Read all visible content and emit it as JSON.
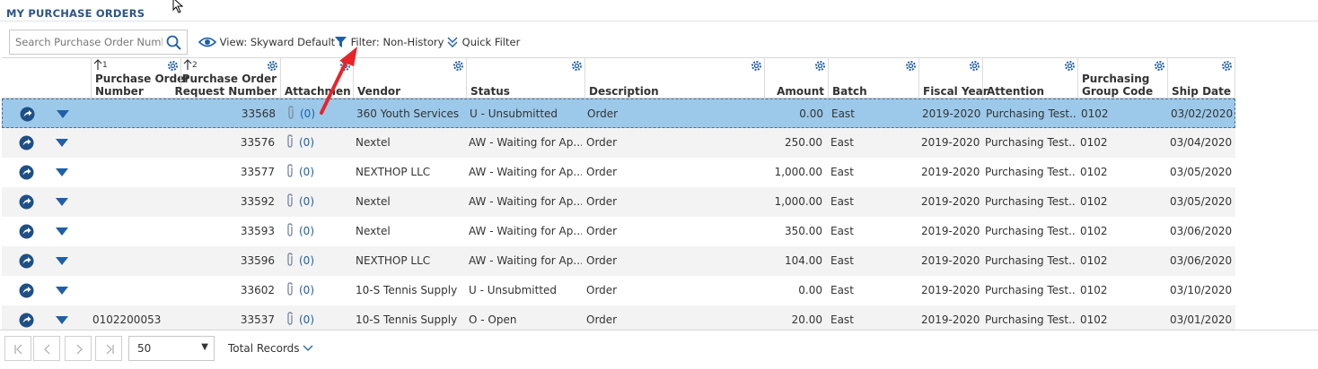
{
  "page": {
    "title": "MY PURCHASE ORDERS"
  },
  "toolbar": {
    "search_placeholder": "Search Purchase Order Number",
    "view_label": "View: Skyward Default",
    "filter_label": "Filter: Non-History",
    "quick_filter_label": "Quick Filter"
  },
  "colors": {
    "accent": "#2c5585",
    "icon_blue": "#1f5fa8",
    "selected_row": "#9cc9ea",
    "annotation_arrow": "#e8242a"
  },
  "columns": [
    {
      "key": "po_number",
      "label1": "Purchase Order",
      "label2": "Number",
      "sort_rank": "1"
    },
    {
      "key": "por_number",
      "label1": "Purchase Order",
      "label2": "Request Number",
      "sort_rank": "2"
    },
    {
      "key": "attachments",
      "label1": "",
      "label2": "Attachments"
    },
    {
      "key": "vendor",
      "label1": "",
      "label2": "Vendor"
    },
    {
      "key": "status",
      "label1": "",
      "label2": "Status"
    },
    {
      "key": "description",
      "label1": "",
      "label2": "Description"
    },
    {
      "key": "amount",
      "label1": "",
      "label2": "Amount"
    },
    {
      "key": "batch",
      "label1": "",
      "label2": "Batch"
    },
    {
      "key": "fiscal_year",
      "label1": "",
      "label2": "Fiscal Year"
    },
    {
      "key": "attention",
      "label1": "",
      "label2": "Attention"
    },
    {
      "key": "pgc",
      "label1": "Purchasing",
      "label2": "Group Code"
    },
    {
      "key": "ship_date",
      "label1": "",
      "label2": "Ship Date"
    }
  ],
  "rows": [
    {
      "po": "",
      "por": "33568",
      "att": "(0)",
      "vendor": "360 Youth Services",
      "status": "U - Unsubmitted",
      "desc": "Order",
      "amount": "0.00",
      "batch": "East",
      "fy": "2019-2020",
      "attention": "Purchasing Test...",
      "pgc": "0102",
      "ship": "03/02/2020",
      "selected": true
    },
    {
      "po": "",
      "por": "33576",
      "att": "(0)",
      "vendor": "Nextel",
      "status": "AW - Waiting for Ap...",
      "desc": "Order",
      "amount": "250.00",
      "batch": "East",
      "fy": "2019-2020",
      "attention": "Purchasing Test...",
      "pgc": "0102",
      "ship": "03/04/2020"
    },
    {
      "po": "",
      "por": "33577",
      "att": "(0)",
      "vendor": "NEXTHOP LLC",
      "status": "AW - Waiting for Ap...",
      "desc": "Order",
      "amount": "1,000.00",
      "batch": "East",
      "fy": "2019-2020",
      "attention": "Purchasing Test...",
      "pgc": "0102",
      "ship": "03/05/2020"
    },
    {
      "po": "",
      "por": "33592",
      "att": "(0)",
      "vendor": "Nextel",
      "status": "AW - Waiting for Ap...",
      "desc": "Order",
      "amount": "1,000.00",
      "batch": "East",
      "fy": "2019-2020",
      "attention": "Purchasing Test...",
      "pgc": "0102",
      "ship": "03/05/2020"
    },
    {
      "po": "",
      "por": "33593",
      "att": "(0)",
      "vendor": "Nextel",
      "status": "AW - Waiting for Ap...",
      "desc": "Order",
      "amount": "350.00",
      "batch": "East",
      "fy": "2019-2020",
      "attention": "Purchasing Test...",
      "pgc": "0102",
      "ship": "03/06/2020"
    },
    {
      "po": "",
      "por": "33596",
      "att": "(0)",
      "vendor": "NEXTHOP LLC",
      "status": "AW - Waiting for Ap...",
      "desc": "Order",
      "amount": "104.00",
      "batch": "East",
      "fy": "2019-2020",
      "attention": "Purchasing Test...",
      "pgc": "0102",
      "ship": "03/06/2020"
    },
    {
      "po": "",
      "por": "33602",
      "att": "(0)",
      "vendor": "10-S Tennis Supply",
      "status": "U - Unsubmitted",
      "desc": "Order",
      "amount": "0.00",
      "batch": "East",
      "fy": "2019-2020",
      "attention": "Purchasing Test...",
      "pgc": "0102",
      "ship": "03/10/2020"
    },
    {
      "po": "0102200053",
      "por": "33537",
      "att": "(0)",
      "vendor": "10-S Tennis Supply",
      "status": "O - Open",
      "desc": "Order",
      "amount": "20.00",
      "batch": "East",
      "fy": "2019-2020",
      "attention": "Purchasing Test...",
      "pgc": "0102",
      "ship": "03/01/2020"
    }
  ],
  "pager": {
    "page_size": "50",
    "total_records_label": "Total Records"
  }
}
